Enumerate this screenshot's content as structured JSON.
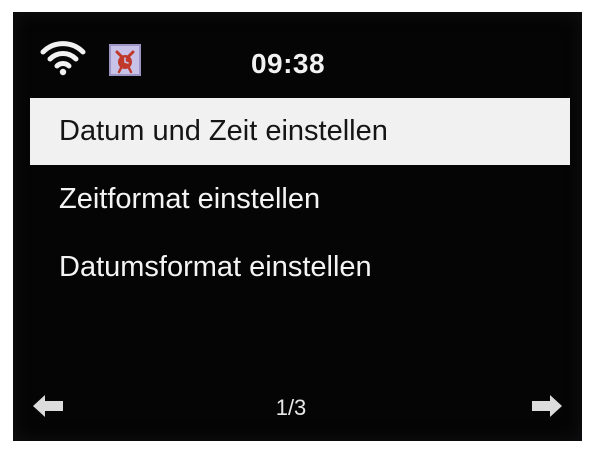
{
  "status_bar": {
    "time": "09:38",
    "wifi_icon": "wifi-icon",
    "alarm_icon": "alarm-icon"
  },
  "menu": {
    "items": [
      {
        "label": "Datum und Zeit einstellen",
        "selected": true
      },
      {
        "label": "Zeitformat einstellen",
        "selected": false
      },
      {
        "label": "Datumsformat einstellen",
        "selected": false
      }
    ]
  },
  "navigation": {
    "page_indicator": "1/3",
    "prev_icon": "arrow-left-icon",
    "next_icon": "arrow-right-icon"
  },
  "colors": {
    "background": "#050505",
    "selection": "#f1f1f1",
    "text": "#f4f4f4",
    "alarm_icon_bg": "#c9c2e8",
    "alarm_icon_fg": "#c0392b"
  }
}
